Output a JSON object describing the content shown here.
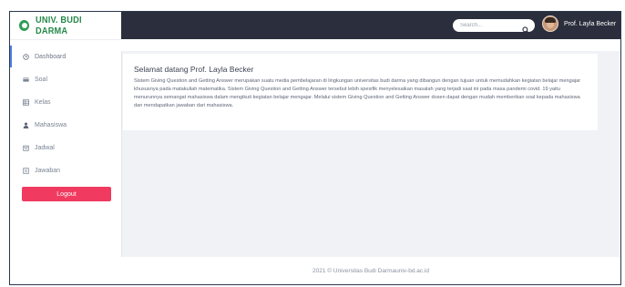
{
  "brand": {
    "name": "UNIV. BUDI DARMA"
  },
  "sidebar": {
    "items": [
      {
        "label": "Dashboard",
        "icon": "clock-icon"
      },
      {
        "label": "Soal",
        "icon": "card-icon"
      },
      {
        "label": "Kelas",
        "icon": "table-icon"
      },
      {
        "label": "Mahasiswa",
        "icon": "user-icon"
      },
      {
        "label": "Jadwal",
        "icon": "calendar-icon"
      },
      {
        "label": "Jawaban",
        "icon": "document-icon"
      }
    ],
    "logout_label": "Logout"
  },
  "header": {
    "search_placeholder": "Search...",
    "user_name": "Prof. Layla Becker"
  },
  "main": {
    "welcome_title": "Selamat datang Prof. Layla Becker",
    "welcome_text": "Sistem Giving Question and Getting Answer merupakan suatu media pembelajaran di lingkungan universitas budi darma yang dibangun dengan tujuan untuk memudahkan kegiatan belajar mengajar khususnya pada matakuliah matematika. Sistem Giving Question and Getting Answer tersebut lebih spesifik menyelesaikan masalah yang terjadi saat ini pada masa pandemi covid. 19 yaitu menurunnya semangat mahasiswa dalam mengikuti kegiatan belajar mengajar. Melalui sistem Giving Question and Getting Answer dosen dapat dengan mudah memberikan soal kepada mahasiswa dan mendapatkan jawaban dari mahasiswa."
  },
  "footer": {
    "text": "2021 © Universitas Budi Darmauniv-bd.ac.id"
  },
  "colors": {
    "logout": "#f03a5f",
    "topbar": "#2b2e3c",
    "brand": "#27894a"
  }
}
